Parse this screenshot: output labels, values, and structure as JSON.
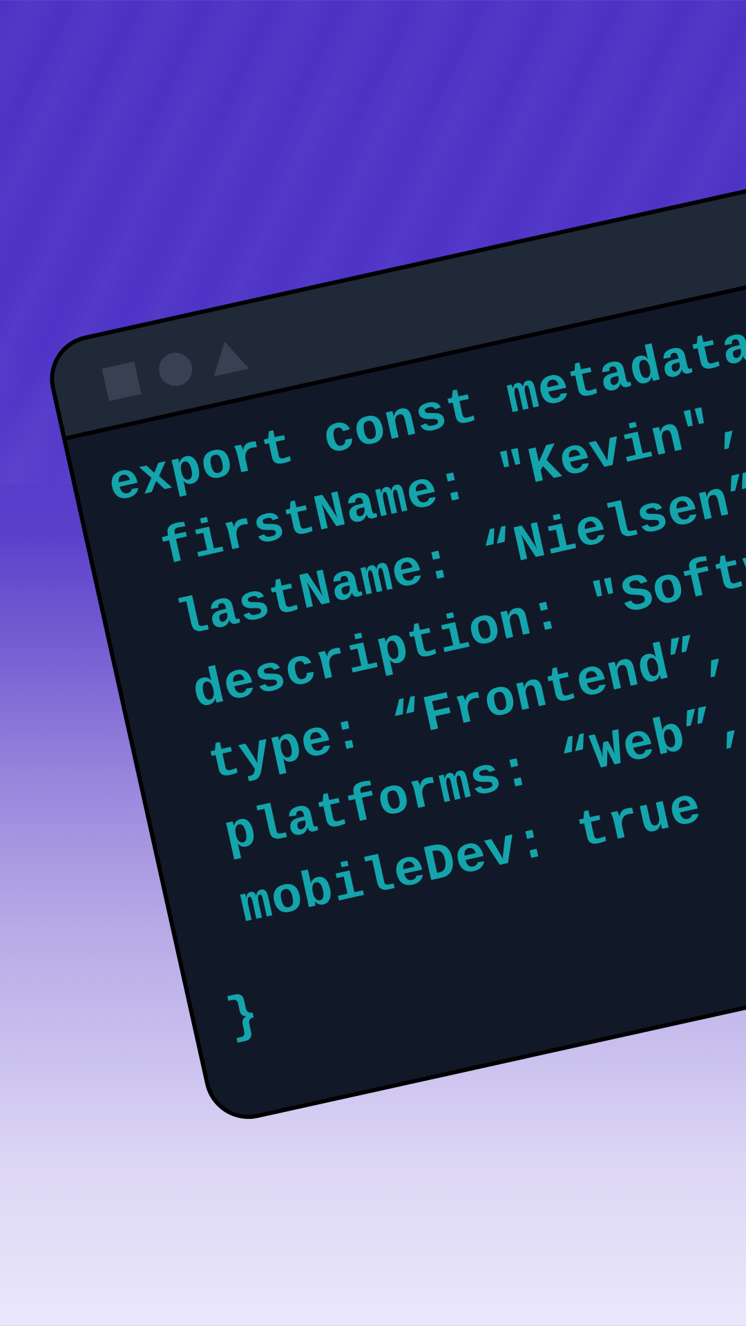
{
  "colors": {
    "background_top": "#4d31c4",
    "background_bottom": "#ebe7fb",
    "window_body": "#111827",
    "window_titlebar": "#1f2937",
    "window_controls": "#374151",
    "code_text": "#14a4ac"
  },
  "window": {
    "controls": [
      "square-icon",
      "circle-icon",
      "triangle-icon"
    ]
  },
  "code": {
    "lines": [
      "export const metadata = {",
      "firstName: \"Kevin\",",
      "lastName: “Nielsen”",
      "description: \"Software Engineer\",",
      "type: “Frontend”,",
      "platforms: “Web”,",
      "mobileDev: true",
      "}"
    ]
  }
}
